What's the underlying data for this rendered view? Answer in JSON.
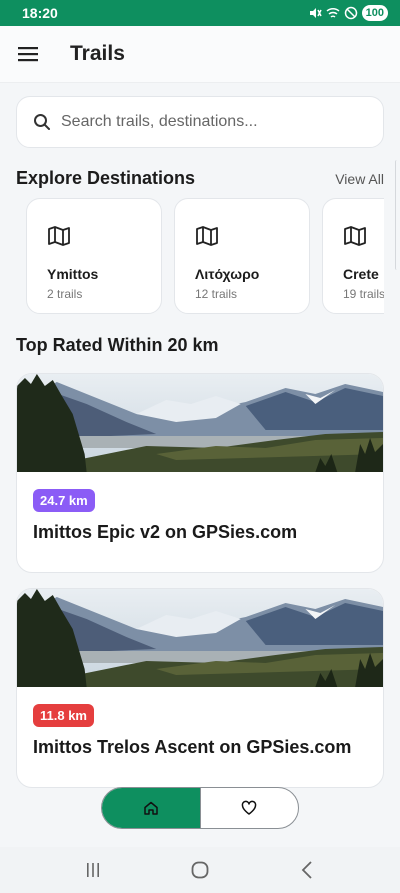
{
  "status_bar": {
    "time": "18:20",
    "battery": "100",
    "icons": [
      "mute-icon",
      "wifi-icon",
      "do-not-disturb-icon"
    ]
  },
  "app_bar": {
    "title": "Trails",
    "menu_icon": "hamburger-menu-icon"
  },
  "search": {
    "placeholder": "Search trails, destinations..."
  },
  "destinations": {
    "title": "Explore Destinations",
    "view_all": "View All",
    "items": [
      {
        "name": "Ymittos",
        "count": "2 trails",
        "icon": "map-icon"
      },
      {
        "name": "Λιτόχωρο",
        "count": "12 trails",
        "icon": "map-icon"
      },
      {
        "name": "Crete",
        "count": "19 trails",
        "icon": "map-icon"
      }
    ]
  },
  "top_rated": {
    "title": "Top Rated Within 20 km",
    "trails": [
      {
        "distance": "24.7 km",
        "name": "Imittos Epic v2 on GPSies.com",
        "badge_color": "#8b5cf6"
      },
      {
        "distance": "11.8 km",
        "name": "Imittos Trelos Ascent on GPSies.com",
        "badge_color": "#e53e3e"
      }
    ]
  },
  "bottom_toggle": {
    "items": [
      {
        "icon": "home-icon",
        "active": true
      },
      {
        "icon": "heart-icon",
        "active": false
      }
    ]
  },
  "colors": {
    "primary": "#0e8f5f",
    "badge_purple": "#8b5cf6",
    "badge_red": "#e53e3e"
  }
}
